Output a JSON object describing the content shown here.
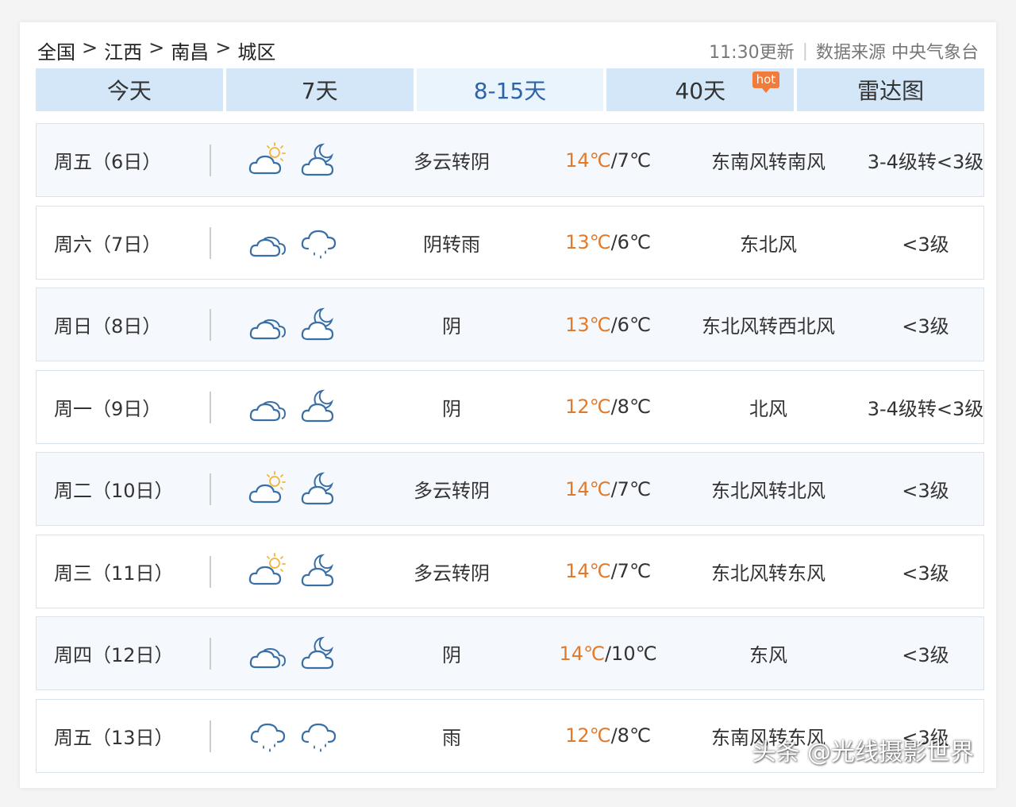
{
  "breadcrumb": [
    "全国",
    "江西",
    "南昌",
    "城区"
  ],
  "breadcrumb_sep": ">",
  "meta": {
    "updated": "11:30更新",
    "divider": "|",
    "source": "数据来源 中央气象台"
  },
  "tabs": [
    {
      "label": "今天",
      "active": false
    },
    {
      "label": "7天",
      "active": false
    },
    {
      "label": "8-15天",
      "active": true
    },
    {
      "label": "40天",
      "active": false,
      "badge": "hot"
    },
    {
      "label": "雷达图",
      "active": false
    }
  ],
  "forecast": [
    {
      "day": "周五（6日）",
      "icons": [
        "partly-cloudy-day-icon",
        "partly-cloudy-night-icon"
      ],
      "desc": "多云转阴",
      "high": "14℃",
      "low": "7℃",
      "wind": "东南风转南风",
      "level": "3-4级转<3级"
    },
    {
      "day": "周六（7日）",
      "icons": [
        "cloudy-icon",
        "rain-icon"
      ],
      "desc": "阴转雨",
      "high": "13℃",
      "low": "6℃",
      "wind": "东北风",
      "level": "<3级"
    },
    {
      "day": "周日（8日）",
      "icons": [
        "cloudy-icon",
        "partly-cloudy-night-icon"
      ],
      "desc": "阴",
      "high": "13℃",
      "low": "6℃",
      "wind": "东北风转西北风",
      "level": "<3级"
    },
    {
      "day": "周一（9日）",
      "icons": [
        "cloudy-icon",
        "partly-cloudy-night-icon"
      ],
      "desc": "阴",
      "high": "12℃",
      "low": "8℃",
      "wind": "北风",
      "level": "3-4级转<3级"
    },
    {
      "day": "周二（10日）",
      "icons": [
        "partly-cloudy-day-icon",
        "partly-cloudy-night-icon"
      ],
      "desc": "多云转阴",
      "high": "14℃",
      "low": "7℃",
      "wind": "东北风转北风",
      "level": "<3级"
    },
    {
      "day": "周三（11日）",
      "icons": [
        "partly-cloudy-day-icon",
        "partly-cloudy-night-icon"
      ],
      "desc": "多云转阴",
      "high": "14℃",
      "low": "7℃",
      "wind": "东北风转东风",
      "level": "<3级"
    },
    {
      "day": "周四（12日）",
      "icons": [
        "cloudy-icon",
        "partly-cloudy-night-icon"
      ],
      "desc": "阴",
      "high": "14℃",
      "low": "10℃",
      "wind": "东风",
      "level": "<3级"
    },
    {
      "day": "周五（13日）",
      "icons": [
        "rain-icon",
        "rain-icon"
      ],
      "desc": "雨",
      "high": "12℃",
      "low": "8℃",
      "wind": "东南风转东风",
      "level": "<3级"
    }
  ],
  "colors": {
    "tab_bg": "#d3e7f8",
    "tab_active_bg": "#eaf4fc",
    "tab_active_text": "#2d63a8",
    "high_temp": "#e27a2b",
    "icon_stroke": "#3a6fa5",
    "icon_sun": "#f2b535",
    "hot_badge": "#f07b3a"
  },
  "watermark": "头条 @光线摄影世界"
}
